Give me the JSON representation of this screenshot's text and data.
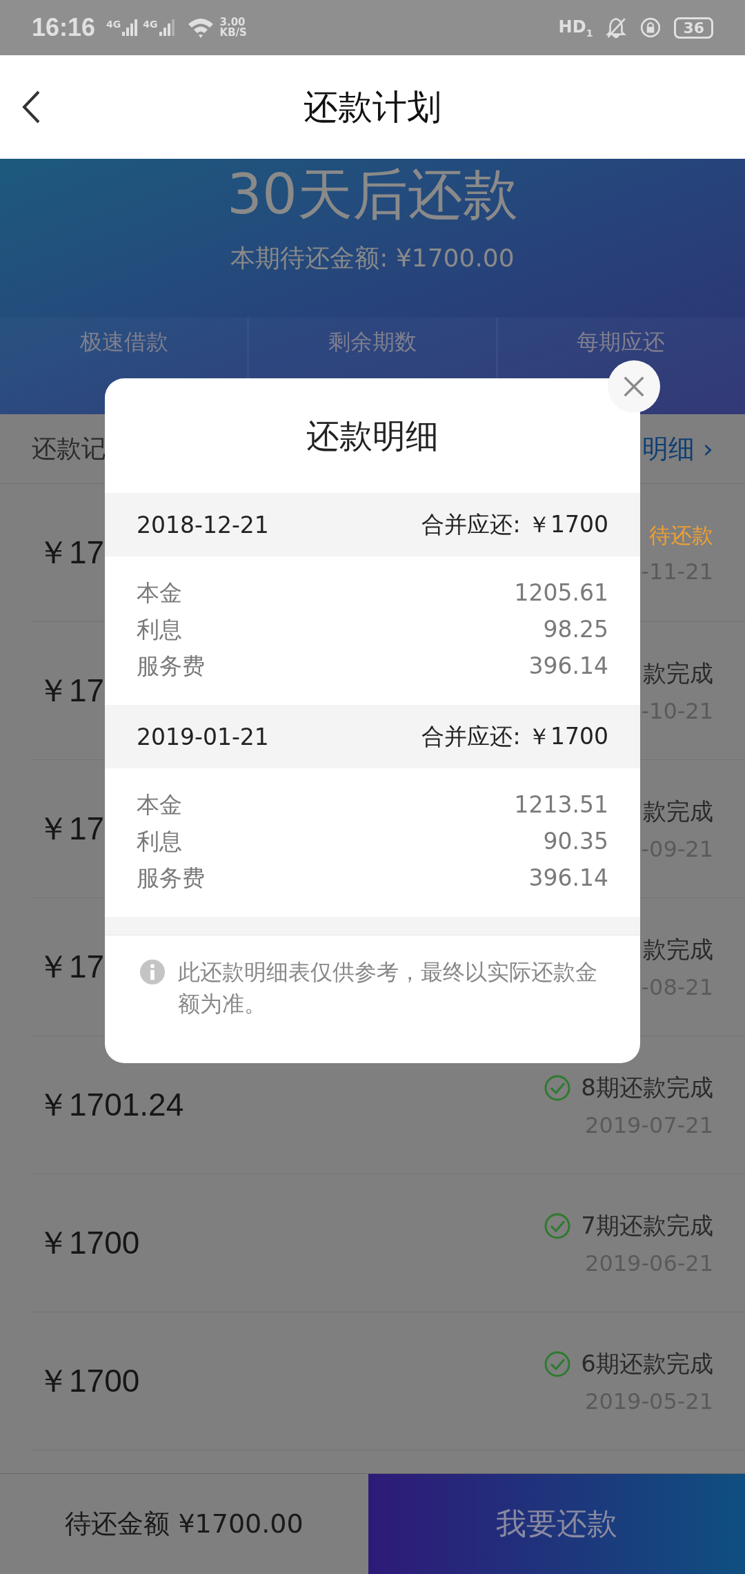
{
  "status_bar": {
    "time": "16:16",
    "networks": [
      "4G",
      "4G"
    ],
    "speed": "3.00",
    "speed_unit": "KB/S",
    "hd": "HD",
    "hd_sim": "1",
    "battery": "36"
  },
  "header": {
    "title": "还款计划"
  },
  "banner": {
    "headline": "30天后还款",
    "subtitle": "本期待还金额: ¥1700.00",
    "stats": [
      "极速借款",
      "剩余期数",
      "每期应还"
    ]
  },
  "records_header": {
    "title": "还款记",
    "link": "明细",
    "link_arrow": "›"
  },
  "rows": [
    {
      "amount": "￥17",
      "kind": "pending",
      "status": "待还款",
      "date": "-11-21"
    },
    {
      "amount": "￥17",
      "kind": "done_clipped",
      "status": "款完成",
      "date": "-10-21"
    },
    {
      "amount": "￥17",
      "kind": "done_clipped",
      "status": "款完成",
      "date": "-09-21"
    },
    {
      "amount": "￥17",
      "kind": "done_clipped",
      "status": "款完成",
      "date": "-08-21"
    },
    {
      "amount": "￥1701.24",
      "kind": "done",
      "status": "8期还款完成",
      "date": "2019-07-21"
    },
    {
      "amount": "￥1700",
      "kind": "done",
      "status": "7期还款完成",
      "date": "2019-06-21"
    },
    {
      "amount": "￥1700",
      "kind": "done",
      "status": "6期还款完成",
      "date": "2019-05-21"
    }
  ],
  "bottom_bar": {
    "pending": "待还金额 ¥1700.00",
    "button": "我要还款"
  },
  "dialog": {
    "title": "还款明细",
    "periods": [
      {
        "date": "2018-12-21",
        "total": "合并应还: ￥1700",
        "items": [
          {
            "label": "本金",
            "value": "1205.61"
          },
          {
            "label": "利息",
            "value": "98.25"
          },
          {
            "label": "服务费",
            "value": "396.14"
          }
        ]
      },
      {
        "date": "2019-01-21",
        "total": "合并应还: ￥1700",
        "items": [
          {
            "label": "本金",
            "value": "1213.51"
          },
          {
            "label": "利息",
            "value": "90.35"
          },
          {
            "label": "服务费",
            "value": "396.14"
          }
        ]
      }
    ],
    "note": "此还款明细表仅供参考，最终以实际还款金额为准。"
  }
}
